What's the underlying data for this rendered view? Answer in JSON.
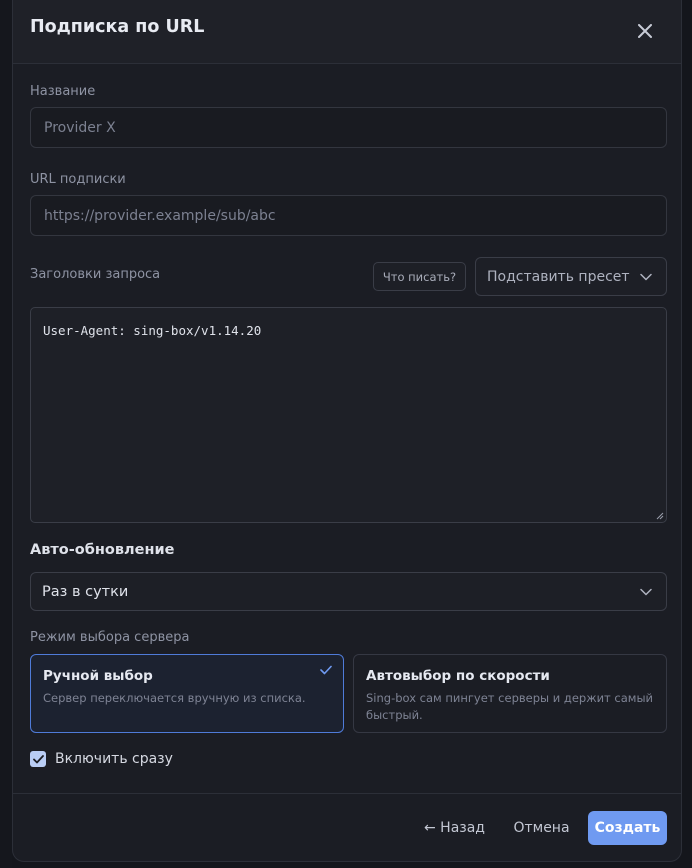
{
  "dialog": {
    "title": "Подписка по URL"
  },
  "fields": {
    "name_label": "Название",
    "name_placeholder": "Provider X",
    "url_label": "URL подписки",
    "url_placeholder": "https://provider.example/sub/abc",
    "headers_label": "Заголовки запроса",
    "headers_hint_button": "Что писать?",
    "preset_select": "Подставить пресет",
    "headers_value": "User-Agent: sing-box/v1.14.20"
  },
  "auto_update": {
    "title": "Авто-обновление",
    "selected": "Раз в сутки"
  },
  "server_mode": {
    "label": "Режим выбора сервера",
    "options": [
      {
        "title": "Ручной выбор",
        "desc": "Сервер переключается вручную из списка.",
        "selected": true
      },
      {
        "title": "Автовыбор по скорости",
        "desc": "Sing-box сам пингует серверы и держит самый быстрый.",
        "selected": false
      }
    ]
  },
  "enable_now": {
    "label": "Включить сразу",
    "checked": true
  },
  "footer": {
    "back": "← Назад",
    "cancel": "Отмена",
    "create": "Создать"
  },
  "colors": {
    "accent": "#6f9af1",
    "selected_border": "#4f7bd8",
    "background": "#1b1d24"
  },
  "icons": [
    "close-icon",
    "chevron-down-icon",
    "check-icon",
    "checkbox-check-icon",
    "resize-grip-icon"
  ]
}
